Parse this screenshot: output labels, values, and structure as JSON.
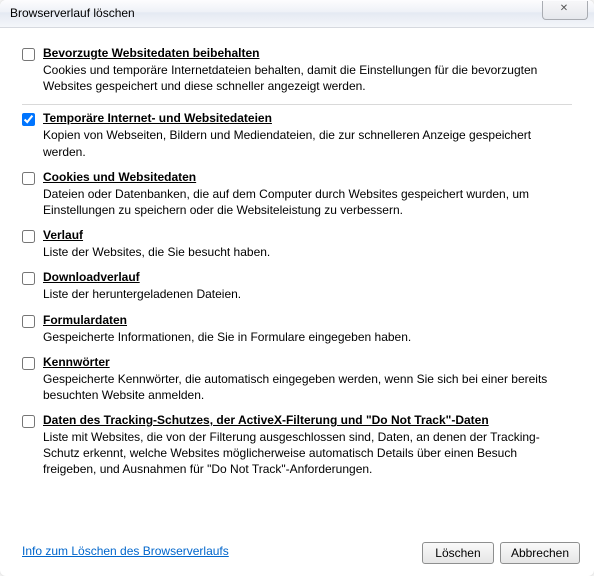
{
  "window": {
    "title": "Browserverlauf löschen",
    "close_glyph": "✕"
  },
  "options": [
    {
      "checked": false,
      "title": "Bevorzugte Websitedaten beibehalten",
      "desc": "Cookies und temporäre Internetdateien behalten, damit die Einstellungen für die bevorzugten Websites gespeichert und diese schneller angezeigt werden."
    },
    {
      "checked": true,
      "title": "Temporäre Internet- und Websitedateien",
      "desc": "Kopien von Webseiten, Bildern und Mediendateien, die zur schnelleren Anzeige gespeichert werden."
    },
    {
      "checked": false,
      "title": "Cookies und Websitedaten",
      "desc": "Dateien oder Datenbanken, die auf dem Computer durch Websites gespeichert wurden, um Einstellungen zu speichern oder die Websiteleistung zu verbessern."
    },
    {
      "checked": false,
      "title": "Verlauf",
      "desc": "Liste der Websites, die Sie besucht haben."
    },
    {
      "checked": false,
      "title": "Downloadverlauf",
      "desc": "Liste der heruntergeladenen Dateien."
    },
    {
      "checked": false,
      "title": "Formulardaten",
      "desc": "Gespeicherte Informationen, die Sie in Formulare eingegeben haben."
    },
    {
      "checked": false,
      "title": "Kennwörter",
      "desc": "Gespeicherte Kennwörter, die automatisch eingegeben werden, wenn Sie sich bei einer bereits besuchten Website anmelden."
    },
    {
      "checked": false,
      "title": "Daten des Tracking-Schutzes, der ActiveX-Filterung und \"Do Not Track\"-Daten",
      "desc": "Liste mit Websites, die von der Filterung ausgeschlossen sind, Daten, an denen der Tracking-Schutz erkennt, welche Websites möglicherweise automatisch Details über einen Besuch freigeben, und Ausnahmen für \"Do Not Track\"-Anforderungen."
    }
  ],
  "footer": {
    "help_link": "Info zum Löschen des Browserverlaufs",
    "delete_label": "Löschen",
    "cancel_label": "Abbrechen"
  }
}
